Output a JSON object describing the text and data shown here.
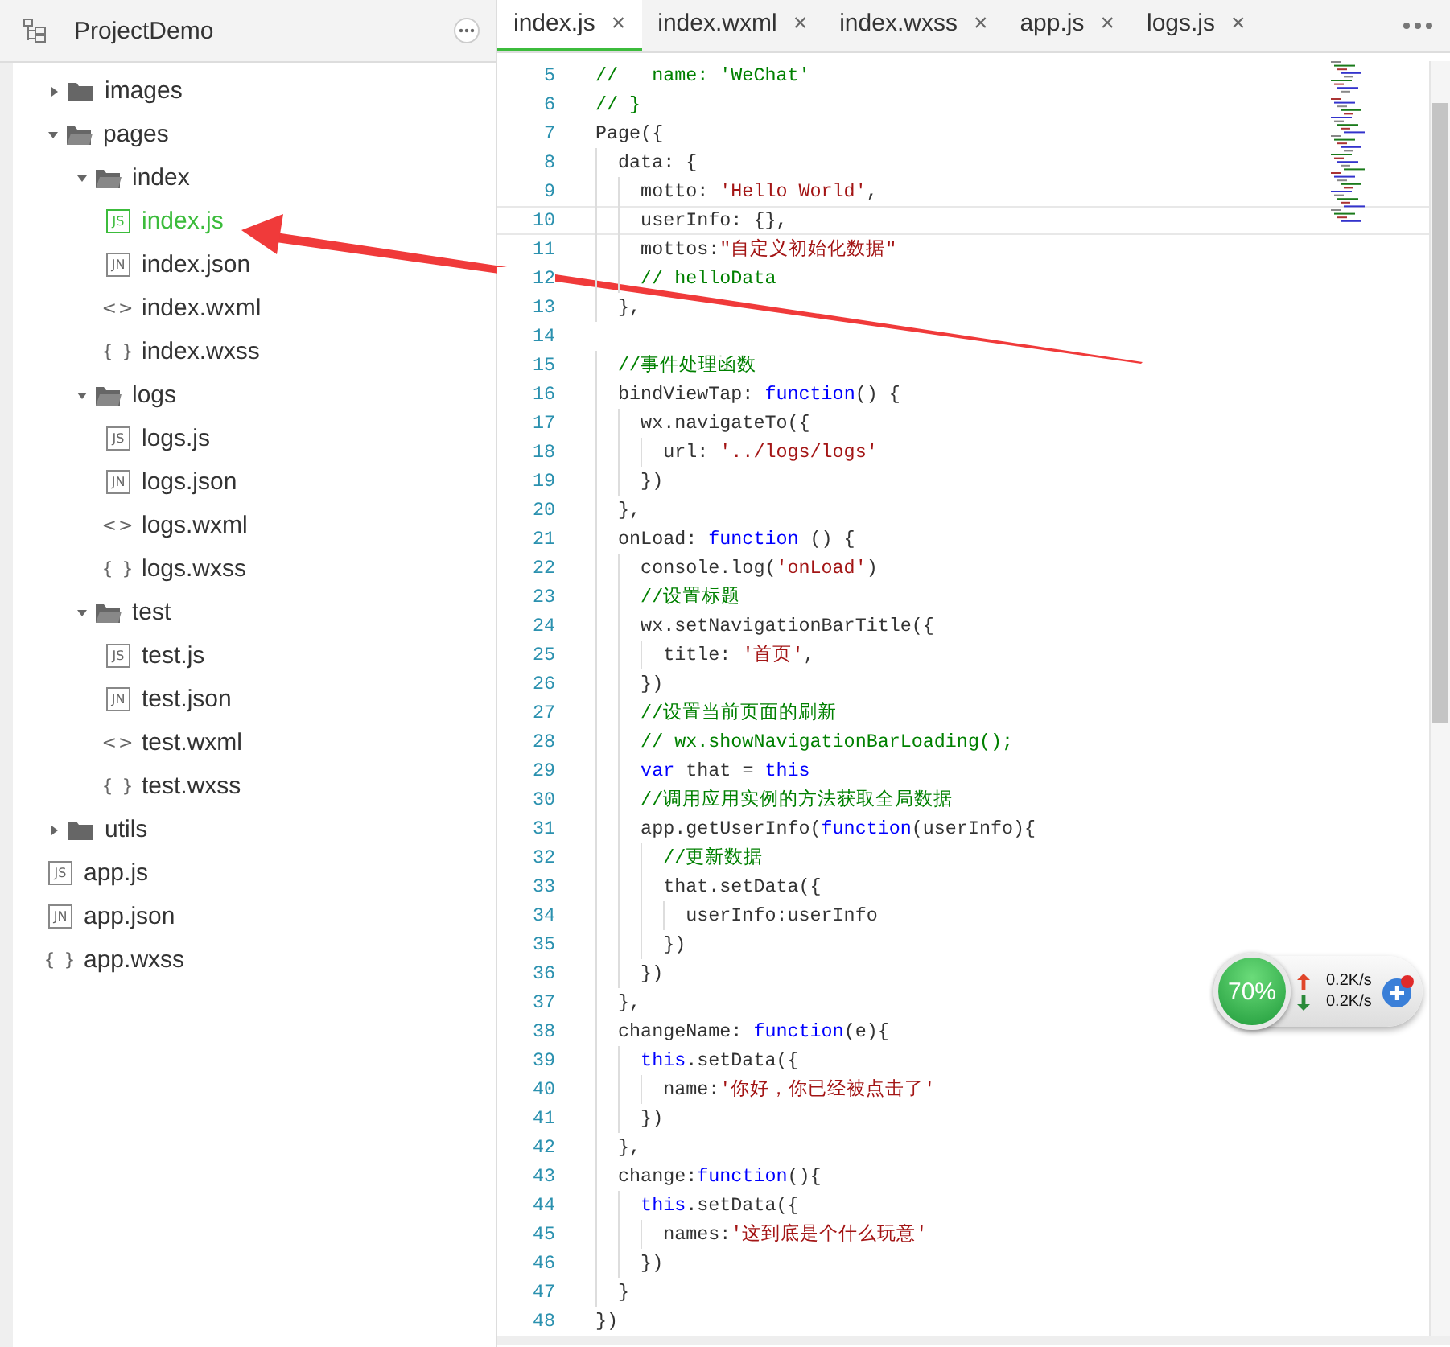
{
  "project": {
    "title": "ProjectDemo"
  },
  "tree": [
    {
      "kind": "folder",
      "label": "images",
      "expanded": false
    },
    {
      "kind": "folder",
      "label": "pages",
      "expanded": true,
      "children": [
        {
          "kind": "folder",
          "label": "index",
          "expanded": true,
          "children": [
            {
              "kind": "file",
              "icon_frame": true,
              "icon": "JS",
              "label": "index.js",
              "selected": true
            },
            {
              "kind": "file",
              "icon_frame": true,
              "icon": "JN",
              "label": "index.json",
              "selected": false
            },
            {
              "kind": "file",
              "icon_frame": false,
              "icon": "<>",
              "label": "index.wxml",
              "selected": false
            },
            {
              "kind": "file",
              "icon_frame": false,
              "icon": "{ }",
              "label": "index.wxss",
              "selected": false
            }
          ]
        },
        {
          "kind": "folder",
          "label": "logs",
          "expanded": true,
          "children": [
            {
              "kind": "file",
              "icon_frame": true,
              "icon": "JS",
              "label": "logs.js",
              "selected": false
            },
            {
              "kind": "file",
              "icon_frame": true,
              "icon": "JN",
              "label": "logs.json",
              "selected": false
            },
            {
              "kind": "file",
              "icon_frame": false,
              "icon": "<>",
              "label": "logs.wxml",
              "selected": false
            },
            {
              "kind": "file",
              "icon_frame": false,
              "icon": "{ }",
              "label": "logs.wxss",
              "selected": false
            }
          ]
        },
        {
          "kind": "folder",
          "label": "test",
          "expanded": true,
          "children": [
            {
              "kind": "file",
              "icon_frame": true,
              "icon": "JS",
              "label": "test.js",
              "selected": false
            },
            {
              "kind": "file",
              "icon_frame": true,
              "icon": "JN",
              "label": "test.json",
              "selected": false
            },
            {
              "kind": "file",
              "icon_frame": false,
              "icon": "<>",
              "label": "test.wxml",
              "selected": false
            },
            {
              "kind": "file",
              "icon_frame": false,
              "icon": "{ }",
              "label": "test.wxss",
              "selected": false
            }
          ]
        }
      ]
    },
    {
      "kind": "folder",
      "label": "utils",
      "expanded": false
    },
    {
      "kind": "file",
      "icon_frame": true,
      "icon": "JS",
      "label": "app.js",
      "selected": false
    },
    {
      "kind": "file",
      "icon_frame": true,
      "icon": "JN",
      "label": "app.json",
      "selected": false
    },
    {
      "kind": "file",
      "icon_frame": false,
      "icon": "{ }",
      "label": "app.wxss",
      "selected": false
    }
  ],
  "tabs": [
    {
      "label": "index.js",
      "close": "×",
      "selected": true
    },
    {
      "label": "index.wxml",
      "close": "×",
      "selected": false
    },
    {
      "label": "index.wxss",
      "close": "×",
      "selected": false
    },
    {
      "label": "app.js",
      "close": "×",
      "selected": false
    },
    {
      "label": "logs.js",
      "close": "×",
      "selected": false
    }
  ],
  "code_lines": [
    {
      "number": "5",
      "current": false,
      "tokens": [
        {
          "kind": "comment",
          "text": "//   name: 'WeChat'"
        }
      ]
    },
    {
      "number": "6",
      "current": false,
      "tokens": [
        {
          "kind": "comment",
          "text": "// }"
        }
      ]
    },
    {
      "number": "7",
      "current": false,
      "tokens": [
        {
          "kind": "plain",
          "text": "Page({"
        }
      ]
    },
    {
      "number": "8",
      "current": false,
      "tokens": [
        {
          "kind": "plain",
          "text": "  data: {"
        }
      ]
    },
    {
      "number": "9",
      "current": false,
      "tokens": [
        {
          "kind": "plain",
          "text": "    motto: "
        },
        {
          "kind": "string",
          "text": "'Hello World'"
        },
        {
          "kind": "plain",
          "text": ","
        }
      ]
    },
    {
      "number": "10",
      "current": true,
      "tokens": [
        {
          "kind": "plain",
          "text": "    userInfo: {},"
        }
      ]
    },
    {
      "number": "11",
      "current": false,
      "tokens": [
        {
          "kind": "plain",
          "text": "    mottos:"
        },
        {
          "kind": "string",
          "text": "\"自定义初始化数据\""
        }
      ]
    },
    {
      "number": "12",
      "current": false,
      "tokens": [
        {
          "kind": "comment",
          "text": "    // helloData"
        }
      ]
    },
    {
      "number": "13",
      "current": false,
      "tokens": [
        {
          "kind": "plain",
          "text": "  },"
        }
      ]
    },
    {
      "number": "14",
      "current": false
    },
    {
      "number": "15",
      "current": false,
      "tokens": [
        {
          "kind": "comment",
          "text": "  //事件处理函数"
        }
      ]
    },
    {
      "number": "16",
      "current": false,
      "tokens": [
        {
          "kind": "plain",
          "text": "  bindViewTap: "
        },
        {
          "kind": "keyword",
          "text": "function"
        },
        {
          "kind": "plain",
          "text": "() {"
        }
      ]
    },
    {
      "number": "17",
      "current": false,
      "tokens": [
        {
          "kind": "plain",
          "text": "    wx.navigateTo({"
        }
      ]
    },
    {
      "number": "18",
      "current": false,
      "tokens": [
        {
          "kind": "plain",
          "text": "      url: "
        },
        {
          "kind": "string",
          "text": "'../logs/logs'"
        }
      ]
    },
    {
      "number": "19",
      "current": false,
      "tokens": [
        {
          "kind": "plain",
          "text": "    })"
        }
      ]
    },
    {
      "number": "20",
      "current": false,
      "tokens": [
        {
          "kind": "plain",
          "text": "  },"
        }
      ]
    },
    {
      "number": "21",
      "current": false,
      "tokens": [
        {
          "kind": "plain",
          "text": "  onLoad: "
        },
        {
          "kind": "keyword",
          "text": "function"
        },
        {
          "kind": "plain",
          "text": " () {"
        }
      ]
    },
    {
      "number": "22",
      "current": false,
      "tokens": [
        {
          "kind": "plain",
          "text": "    console.log("
        },
        {
          "kind": "string",
          "text": "'onLoad'"
        },
        {
          "kind": "plain",
          "text": ")"
        }
      ]
    },
    {
      "number": "23",
      "current": false,
      "tokens": [
        {
          "kind": "comment",
          "text": "    //设置标题"
        }
      ]
    },
    {
      "number": "24",
      "current": false,
      "tokens": [
        {
          "kind": "plain",
          "text": "    wx.setNavigationBarTitle({"
        }
      ]
    },
    {
      "number": "25",
      "current": false,
      "tokens": [
        {
          "kind": "plain",
          "text": "      title: "
        },
        {
          "kind": "string",
          "text": "'首页'"
        },
        {
          "kind": "plain",
          "text": ","
        }
      ]
    },
    {
      "number": "26",
      "current": false,
      "tokens": [
        {
          "kind": "plain",
          "text": "    })"
        }
      ]
    },
    {
      "number": "27",
      "current": false,
      "tokens": [
        {
          "kind": "comment",
          "text": "    //设置当前页面的刷新"
        }
      ]
    },
    {
      "number": "28",
      "current": false,
      "tokens": [
        {
          "kind": "comment",
          "text": "    // wx.showNavigationBarLoading();"
        }
      ]
    },
    {
      "number": "29",
      "current": false,
      "tokens": [
        {
          "kind": "keyword",
          "text": "    var"
        },
        {
          "kind": "plain",
          "text": " that = "
        },
        {
          "kind": "keyword",
          "text": "this"
        }
      ]
    },
    {
      "number": "30",
      "current": false,
      "tokens": [
        {
          "kind": "comment",
          "text": "    //调用应用实例的方法获取全局数据"
        }
      ]
    },
    {
      "number": "31",
      "current": false,
      "tokens": [
        {
          "kind": "plain",
          "text": "    app.getUserInfo("
        },
        {
          "kind": "keyword",
          "text": "function"
        },
        {
          "kind": "plain",
          "text": "(userInfo){"
        }
      ]
    },
    {
      "number": "32",
      "current": false,
      "tokens": [
        {
          "kind": "comment",
          "text": "      //更新数据"
        }
      ]
    },
    {
      "number": "33",
      "current": false,
      "tokens": [
        {
          "kind": "plain",
          "text": "      that.setData({"
        }
      ]
    },
    {
      "number": "34",
      "current": false,
      "tokens": [
        {
          "kind": "plain",
          "text": "        userInfo:userInfo"
        }
      ]
    },
    {
      "number": "35",
      "current": false,
      "tokens": [
        {
          "kind": "plain",
          "text": "      })"
        }
      ]
    },
    {
      "number": "36",
      "current": false,
      "tokens": [
        {
          "kind": "plain",
          "text": "    })"
        }
      ]
    },
    {
      "number": "37",
      "current": false,
      "tokens": [
        {
          "kind": "plain",
          "text": "  },"
        }
      ]
    },
    {
      "number": "38",
      "current": false,
      "tokens": [
        {
          "kind": "plain",
          "text": "  changeName: "
        },
        {
          "kind": "keyword",
          "text": "function"
        },
        {
          "kind": "plain",
          "text": "(e){"
        }
      ]
    },
    {
      "number": "39",
      "current": false,
      "tokens": [
        {
          "kind": "keyword",
          "text": "    this"
        },
        {
          "kind": "plain",
          "text": ".setData({"
        }
      ]
    },
    {
      "number": "40",
      "current": false,
      "tokens": [
        {
          "kind": "plain",
          "text": "      name:"
        },
        {
          "kind": "string",
          "text": "'你好，你已经被点击了'"
        }
      ]
    },
    {
      "number": "41",
      "current": false,
      "tokens": [
        {
          "kind": "plain",
          "text": "    })"
        }
      ]
    },
    {
      "number": "42",
      "current": false,
      "tokens": [
        {
          "kind": "plain",
          "text": "  },"
        }
      ]
    },
    {
      "number": "43",
      "current": false,
      "tokens": [
        {
          "kind": "plain",
          "text": "  change:"
        },
        {
          "kind": "keyword",
          "text": "function"
        },
        {
          "kind": "plain",
          "text": "(){"
        }
      ]
    },
    {
      "number": "44",
      "current": false,
      "tokens": [
        {
          "kind": "keyword",
          "text": "    this"
        },
        {
          "kind": "plain",
          "text": ".setData({"
        }
      ]
    },
    {
      "number": "45",
      "current": false,
      "tokens": [
        {
          "kind": "plain",
          "text": "      names:"
        },
        {
          "kind": "string",
          "text": "'这到底是个什么玩意'"
        }
      ]
    },
    {
      "number": "46",
      "current": false,
      "tokens": [
        {
          "kind": "plain",
          "text": "    })"
        }
      ]
    },
    {
      "number": "47",
      "current": false,
      "tokens": [
        {
          "kind": "plain",
          "text": "  }"
        }
      ]
    },
    {
      "number": "48",
      "current": false,
      "tokens": [
        {
          "kind": "plain",
          "text": "})"
        }
      ]
    }
  ],
  "net_widget": {
    "percent": "70%",
    "upload": "0.2K/s",
    "download": "0.2K/s"
  }
}
